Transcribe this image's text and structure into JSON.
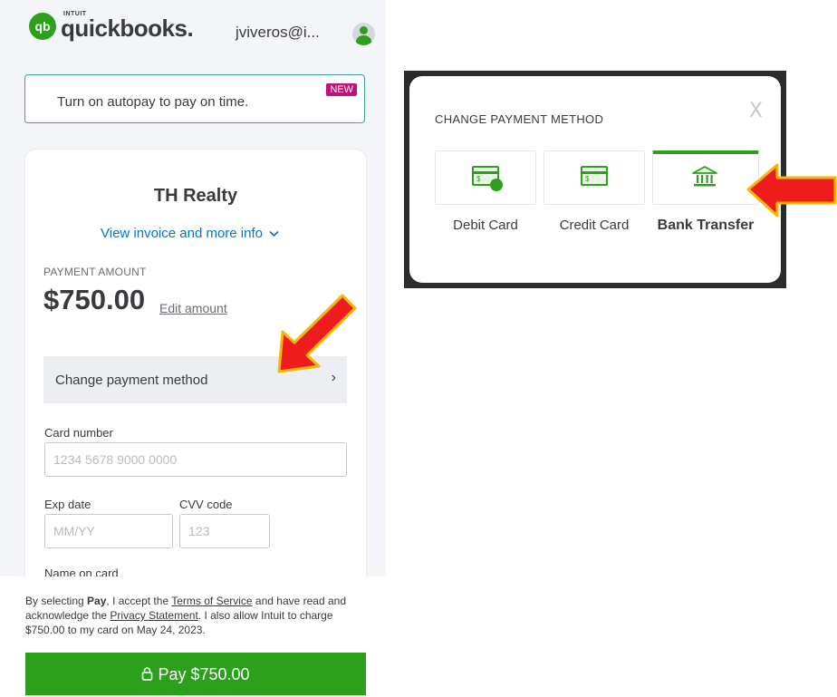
{
  "header": {
    "logo_small": "INTUIT",
    "logo_word": "quickbooks.",
    "logo_mark": "qb",
    "user_email": "jviveros@i..."
  },
  "autopay": {
    "text": "Turn on autopay to pay on time.",
    "badge": "NEW"
  },
  "invoice": {
    "merchant": "TH Realty",
    "view_link": "View invoice and more info",
    "amount_label": "PAYMENT AMOUNT",
    "amount": "$750.00",
    "edit_label": "Edit amount"
  },
  "change_method": {
    "label": "Change payment method",
    "chevron": "›"
  },
  "form": {
    "card_number_label": "Card number",
    "card_number_placeholder": "1234 5678 9000 0000",
    "exp_label": "Exp date",
    "exp_placeholder": "MM/YY",
    "cvv_label": "CVV code",
    "cvv_placeholder": "123",
    "name_label": "Name on card"
  },
  "legal": {
    "p1": "By selecting ",
    "pay_word": "Pay",
    "p2": ", I accept the ",
    "terms": "Terms of Service",
    "p3": " and have read and acknowledge the ",
    "privacy": "Privacy Statement",
    "p4": ". I also allow Intuit to charge $750.00 to my card on May 24, 2023."
  },
  "pay_button": {
    "lock": "🔒",
    "label": "Pay $750.00"
  },
  "modal": {
    "title": "CHANGE PAYMENT METHOD",
    "close": "X",
    "methods": [
      {
        "label": "Debit Card",
        "icon": "debit-card-icon",
        "selected": false
      },
      {
        "label": "Credit Card",
        "icon": "credit-card-icon",
        "selected": false
      },
      {
        "label": "Bank Transfer",
        "icon": "bank-icon",
        "selected": true
      }
    ]
  },
  "colors": {
    "brand_green": "#2ca01c",
    "link_blue": "#0077c5",
    "badge_magenta": "#c0137a",
    "arrow_red": "#ee1c1c",
    "arrow_outline": "#f5b800"
  }
}
